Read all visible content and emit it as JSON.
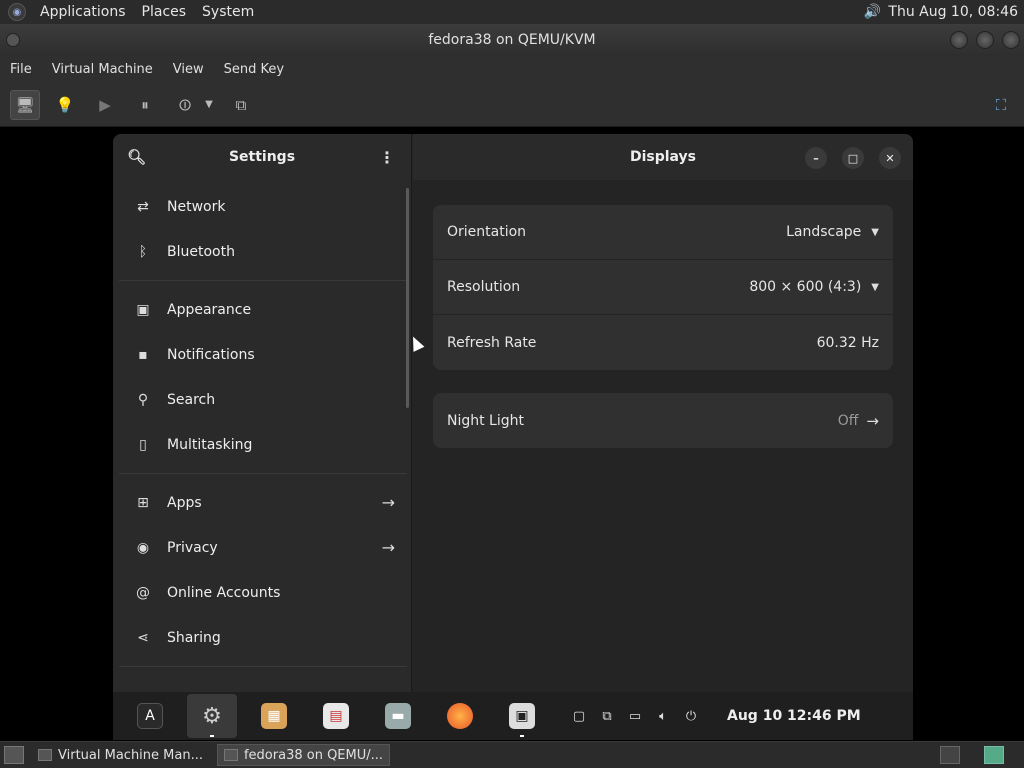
{
  "host_panel": {
    "menus": [
      "Applications",
      "Places",
      "System"
    ],
    "clock": "Thu Aug 10, 08:46"
  },
  "window": {
    "title": "fedora38 on QEMU/KVM",
    "menubar": [
      "File",
      "Virtual Machine",
      "View",
      "Send Key"
    ]
  },
  "settings": {
    "sidebar_title": "Settings",
    "page_title": "Displays",
    "sidebar_items": [
      {
        "label": "Network",
        "icon": "network-icon"
      },
      {
        "label": "Bluetooth",
        "icon": "bluetooth-icon"
      },
      {
        "label": "Appearance",
        "icon": "appearance-icon"
      },
      {
        "label": "Notifications",
        "icon": "notifications-icon"
      },
      {
        "label": "Search",
        "icon": "search-icon"
      },
      {
        "label": "Multitasking",
        "icon": "multitasking-icon"
      },
      {
        "label": "Apps",
        "icon": "apps-icon"
      },
      {
        "label": "Privacy",
        "icon": "privacy-icon"
      },
      {
        "label": "Online Accounts",
        "icon": "online-accounts-icon"
      },
      {
        "label": "Sharing",
        "icon": "sharing-icon"
      }
    ],
    "display_rows": [
      {
        "label": "Orientation",
        "value": "Landscape"
      },
      {
        "label": "Resolution",
        "value": "800 × 600 (4:3)"
      },
      {
        "label": "Refresh Rate",
        "value": "60.32 Hz"
      }
    ],
    "night_light": {
      "label": "Night Light",
      "value": "Off"
    }
  },
  "guest_dock": {
    "clock": "Aug 10  12:46 PM"
  },
  "host_taskbar": {
    "tasks": [
      "Virtual Machine Man...",
      "fedora38 on QEMU/..."
    ]
  }
}
